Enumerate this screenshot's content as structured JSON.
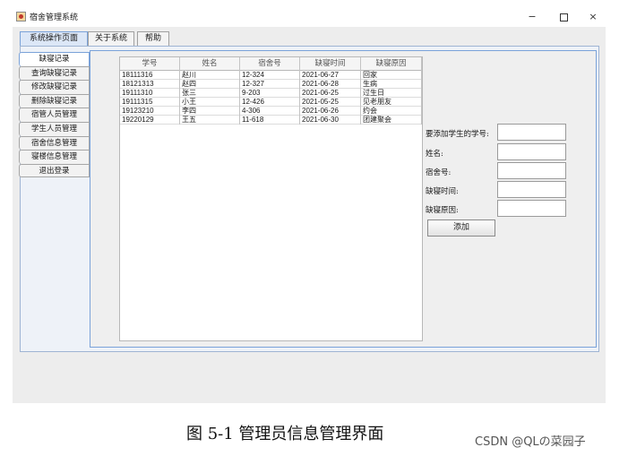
{
  "window": {
    "title": "宿舍管理系统",
    "controls": {
      "minimize": "−",
      "close": "×"
    }
  },
  "top_tabs": [
    {
      "label": "系统操作页面",
      "active": true
    },
    {
      "label": "关于系统",
      "active": false
    },
    {
      "label": "帮助",
      "active": false
    }
  ],
  "side_tabs": [
    {
      "label": "缺寝记录",
      "active": true
    },
    {
      "label": "查询缺寝记录",
      "active": false
    },
    {
      "label": "修改缺寝记录",
      "active": false
    },
    {
      "label": "删除缺寝记录",
      "active": false
    },
    {
      "label": "宿管人员管理",
      "active": false
    },
    {
      "label": "学生人员管理",
      "active": false
    },
    {
      "label": "宿舍信息管理",
      "active": false
    },
    {
      "label": "寝楼信息管理",
      "active": false
    },
    {
      "label": "退出登录",
      "active": false
    }
  ],
  "table": {
    "columns": [
      "学号",
      "姓名",
      "宿舍号",
      "缺寝时间",
      "缺寝原因"
    ],
    "rows": [
      [
        "18111316",
        "赵川",
        "12-324",
        "2021-06-27",
        "回家"
      ],
      [
        "18121313",
        "赵四",
        "12-327",
        "2021-06-28",
        "生病"
      ],
      [
        "19111310",
        "张三",
        "9-203",
        "2021-06-25",
        "过生日"
      ],
      [
        "19111315",
        "小王",
        "12-426",
        "2021-05-25",
        "见老朋友"
      ],
      [
        "19123210",
        "李四",
        "4-306",
        "2021-06-26",
        "约会"
      ],
      [
        "19220129",
        "王五",
        "11-618",
        "2021-06-30",
        "团建聚会"
      ]
    ]
  },
  "form": {
    "student_id_label": "要添加学生的学号:",
    "name_label": "姓名:",
    "room_label": "宿舍号:",
    "absent_time_label": "缺寝时间:",
    "absent_reason_label": "缺寝原因:",
    "student_id_value": "",
    "name_value": "",
    "room_value": "",
    "absent_time_value": "",
    "absent_reason_value": "",
    "add_button": "添加"
  },
  "caption": "图 5-1   管理员信息管理界面",
  "watermark": "CSDN @QLの菜园子"
}
